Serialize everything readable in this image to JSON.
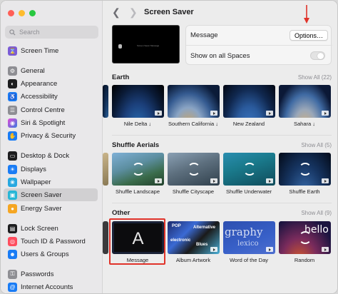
{
  "window": {
    "title": "Screen Saver"
  },
  "sidebar": {
    "search_placeholder": "Search",
    "items": [
      {
        "label": "Screen Time",
        "icon": "hourglass-icon",
        "color": "#7b5cd6"
      },
      {
        "label": "General",
        "icon": "gear-icon",
        "color": "#8e8e93"
      },
      {
        "label": "Appearance",
        "icon": "appearance-icon",
        "color": "#1d1d1f"
      },
      {
        "label": "Accessibility",
        "icon": "accessibility-icon",
        "color": "#1a7cf5"
      },
      {
        "label": "Control Centre",
        "icon": "control-centre-icon",
        "color": "#8e8e93"
      },
      {
        "label": "Siri & Spotlight",
        "icon": "siri-icon",
        "color": "#b03adb"
      },
      {
        "label": "Privacy & Security",
        "icon": "hand-icon",
        "color": "#1a7cf5"
      },
      {
        "label": "Desktop & Dock",
        "icon": "dock-icon",
        "color": "#1d1d1f"
      },
      {
        "label": "Displays",
        "icon": "display-icon",
        "color": "#1a7cf5"
      },
      {
        "label": "Wallpaper",
        "icon": "wallpaper-icon",
        "color": "#27a8e0"
      },
      {
        "label": "Screen Saver",
        "icon": "screen-saver-icon",
        "color": "#27b6d6",
        "selected": true
      },
      {
        "label": "Energy Saver",
        "icon": "bulb-icon",
        "color": "#f5a623"
      },
      {
        "label": "Lock Screen",
        "icon": "lock-icon",
        "color": "#1d1d1f"
      },
      {
        "label": "Touch ID & Password",
        "icon": "fingerprint-icon",
        "color": "#ff4d5e"
      },
      {
        "label": "Users & Groups",
        "icon": "users-icon",
        "color": "#1a7cf5"
      },
      {
        "label": "Passwords",
        "icon": "key-icon",
        "color": "#8e8e93"
      },
      {
        "label": "Internet Accounts",
        "icon": "at-icon",
        "color": "#1a7cf5"
      }
    ]
  },
  "settings": {
    "message_label": "Message",
    "options_button": "Options…",
    "show_all_spaces_label": "Show on all Spaces",
    "show_all_spaces_on": false
  },
  "sections": {
    "earth": {
      "title": "Earth",
      "show_all": "Show All (22)",
      "items": [
        "Nile Delta ↓",
        "Southern California ↓",
        "New Zealand",
        "Sahara ↓"
      ]
    },
    "shuffle": {
      "title": "Shuffle Aerials",
      "show_all": "Show All (5)",
      "items": [
        "Shuffle Landscape",
        "Shuffle Cityscape",
        "Shuffle Underwater",
        "Shuffle Earth"
      ]
    },
    "other": {
      "title": "Other",
      "show_all": "Show All (9)",
      "items": [
        "Message",
        "Album Artwork",
        "Word of the Day",
        "Random"
      ],
      "message_letter": "A",
      "word_text_1": "graphy",
      "word_text_2": "lexico",
      "random_text": "hello",
      "album_tags": [
        "POP",
        "Alternative",
        "electronic",
        "Blues"
      ]
    }
  },
  "preview": {
    "caption": "Screen Saver Message"
  },
  "colors": {
    "highlight": "#e0332a",
    "annotation_arrow": "#e0332a"
  }
}
